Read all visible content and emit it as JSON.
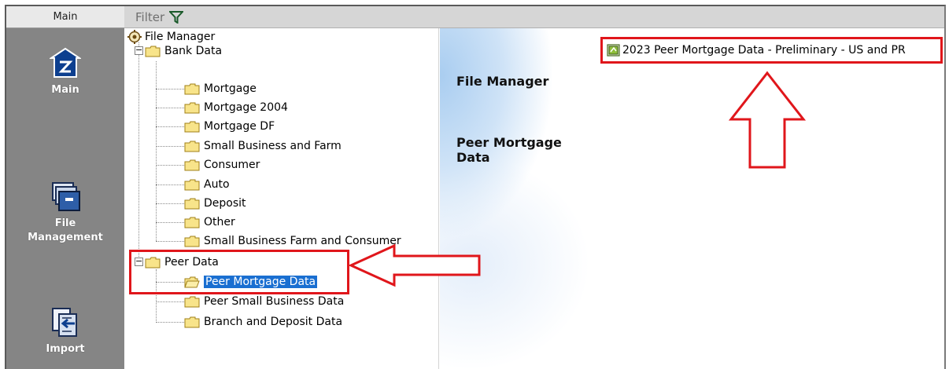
{
  "nav": {
    "header": "Main",
    "buttons": [
      {
        "label": "Main",
        "icon": "home-icon"
      },
      {
        "label": "File Management",
        "label_lines": [
          "File",
          "Management"
        ],
        "icon": "file-cabinet-icon"
      },
      {
        "label": "Import",
        "icon": "import-icon"
      }
    ]
  },
  "filter": {
    "label": "Filter",
    "icon": "filter-icon"
  },
  "tree": {
    "root": "File Manager",
    "groups": [
      {
        "label": "Bank Data",
        "expanded": true,
        "items": [
          "Mortgage",
          "Mortgage 2004",
          "Mortgage DF",
          "Small Business and Farm",
          "Consumer",
          "Auto",
          "Deposit",
          "Other",
          "Small Business Farm and Consumer"
        ]
      },
      {
        "label": "Peer Data",
        "expanded": true,
        "items": [
          "Peer Mortgage Data",
          "Peer Small Business Data",
          "Branch and Deposit Data"
        ],
        "selected": "Peer Mortgage Data"
      }
    ]
  },
  "panel": {
    "title": "File Manager",
    "subtitle": "Peer Mortgage Data",
    "report": "2023 Peer Mortgage Data - Preliminary - US and PR"
  },
  "colors": {
    "highlight_red": "#e0161b",
    "selection_blue": "#1a6fd1",
    "nav_gray": "#858585"
  }
}
